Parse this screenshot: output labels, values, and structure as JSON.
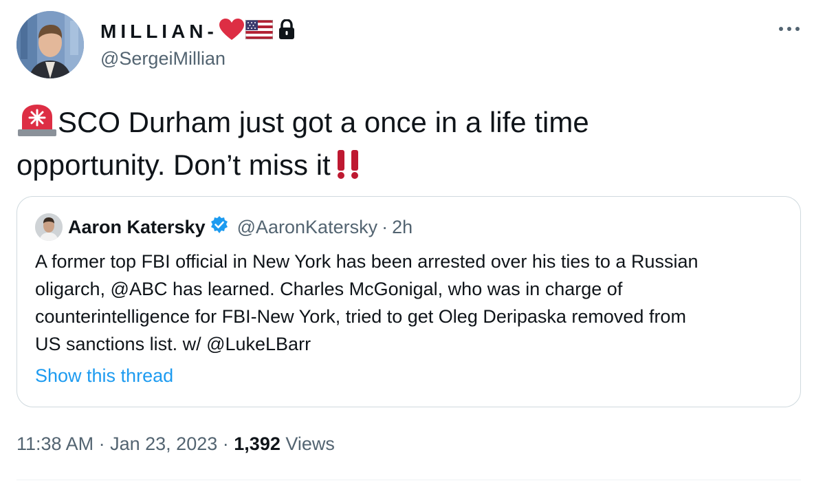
{
  "author": {
    "display_name": "MILLIAN-",
    "handle": "@SergeiMillian"
  },
  "tweet": {
    "line1": "SCO Durham just got a once in a life time",
    "line2": "opportunity. Don’t miss it"
  },
  "quote": {
    "name": "Aaron Katersky",
    "handle": "@AaronKatersky",
    "separator": "·",
    "time": "2h",
    "body_lines": [
      "A former top FBI official in New York has been arrested over his ties to a Russian",
      "oligarch, @ABC has learned. Charles McGonigal, who was in charge of",
      "counterintelligence for FBI-New York, tried to get Oleg Deripaska removed from",
      "US sanctions list.  w/ @LukeLBarr"
    ],
    "show_thread": "Show this thread"
  },
  "meta": {
    "time": "11:38 AM",
    "separator": "·",
    "date": "Jan 23, 2023",
    "views_count": "1,392",
    "views_label": "Views"
  },
  "icons": {
    "more": "more-horizontal-icon",
    "heart": "red-heart-emoji",
    "flag": "us-flag-emoji",
    "lock": "lock-icon",
    "siren": "police-light-emoji",
    "exclaim": "double-exclamation-emoji",
    "verified": "verified-badge-icon"
  },
  "colors": {
    "link": "#1d9bf0",
    "secondary_text": "#536471",
    "primary_text": "#0f1419",
    "border": "#cfd9de"
  }
}
